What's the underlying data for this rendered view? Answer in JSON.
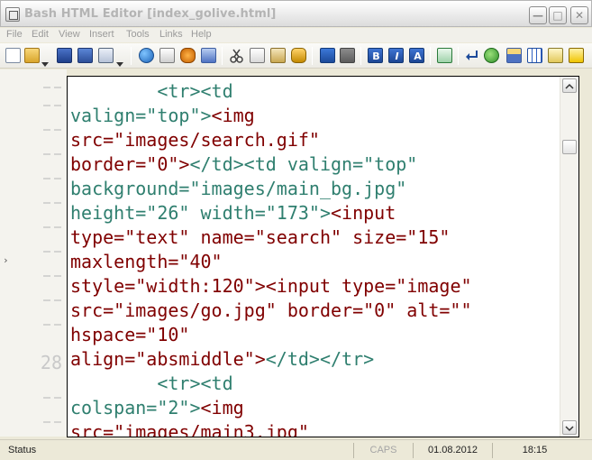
{
  "window": {
    "title": "Bash HTML Editor [index_golive.html]",
    "min_glyph": "—",
    "max_glyph": "□",
    "close_glyph": "✕"
  },
  "menu": {
    "items": [
      "File",
      "Edit",
      "View",
      "Insert",
      "Tools",
      "Links",
      "Help"
    ]
  },
  "toolbar": {
    "bold_label": "B",
    "italic_label": "I",
    "a_label": "A"
  },
  "gutter": {
    "line_number": "28",
    "marker": "›"
  },
  "editor": {
    "lines": [
      [
        {
          "t": "        ",
          "c": "attr"
        },
        {
          "t": "<tr><td",
          "c": "attr"
        }
      ],
      [
        {
          "t": "valign=\"top\">",
          "c": "attr"
        },
        {
          "t": "<img",
          "c": "tag"
        }
      ],
      [
        {
          "t": "src=\"images/search.gif\"",
          "c": "tag"
        }
      ],
      [
        {
          "t": "border=\"0\">",
          "c": "tag"
        },
        {
          "t": "</td><td valign=\"top\"",
          "c": "attr"
        }
      ],
      [
        {
          "t": "background=\"images/main_bg.jpg\"",
          "c": "attr"
        }
      ],
      [
        {
          "t": "height=\"26\" width=\"173\">",
          "c": "attr"
        },
        {
          "t": "<input",
          "c": "tag"
        }
      ],
      [
        {
          "t": "type=\"text\" name=\"search\" size=\"15\"",
          "c": "tag"
        }
      ],
      [
        {
          "t": "maxlength=\"40\"",
          "c": "tag"
        }
      ],
      [
        {
          "t": "style=\"width:120\">",
          "c": "tag"
        },
        {
          "t": "<input type=\"image\"",
          "c": "tag"
        }
      ],
      [
        {
          "t": "src=\"images/go.jpg\" border=\"0\" alt=\"\"",
          "c": "tag"
        }
      ],
      [
        {
          "t": "hspace=\"10\"",
          "c": "tag"
        }
      ],
      [
        {
          "t": "align=\"absmiddle\">",
          "c": "tag"
        },
        {
          "t": "</td></tr>",
          "c": "attr"
        }
      ],
      [
        {
          "t": "        ",
          "c": "attr"
        },
        {
          "t": "<tr><td",
          "c": "attr"
        }
      ],
      [
        {
          "t": "colspan=\"2\">",
          "c": "attr"
        },
        {
          "t": "<img",
          "c": "tag"
        }
      ],
      [
        {
          "t": "src=\"images/main3.jpg\"",
          "c": "tag"
        }
      ]
    ]
  },
  "status": {
    "label": "Status",
    "caps": "CAPS",
    "date": "01.08.2012",
    "time": "18:15"
  },
  "colors": {
    "attr": "#2f7f6f",
    "tag": "#800000"
  }
}
